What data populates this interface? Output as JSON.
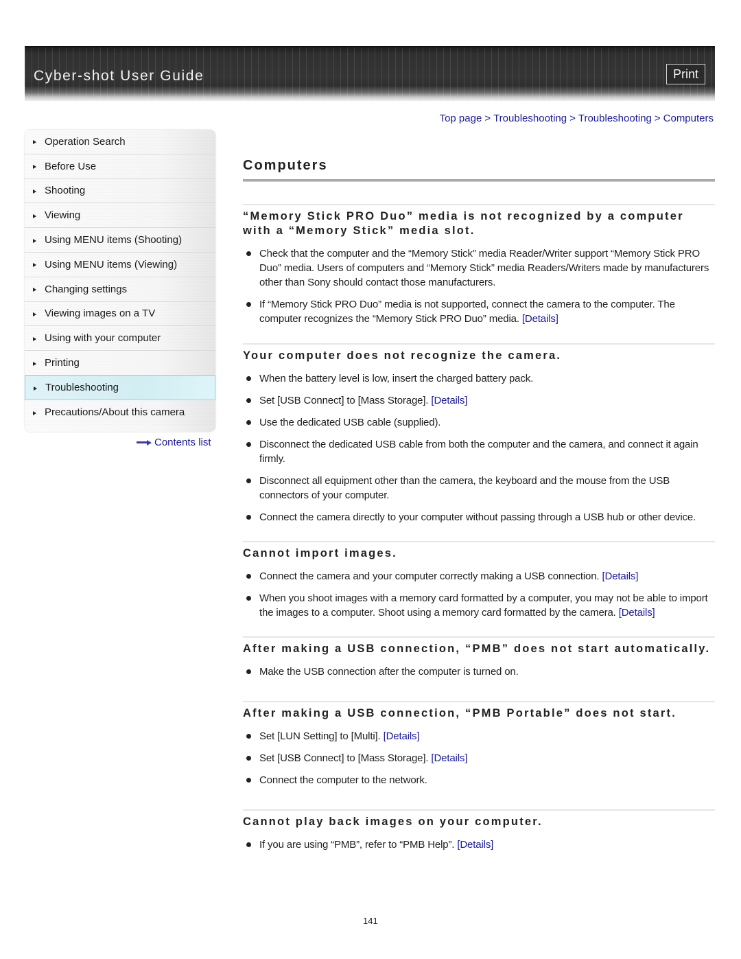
{
  "header": {
    "title": "Cyber-shot User Guide",
    "print_label": "Print"
  },
  "breadcrumb": [
    {
      "label": "Top page"
    },
    {
      "label": "Troubleshooting"
    },
    {
      "label": "Troubleshooting"
    },
    {
      "label": "Computers"
    }
  ],
  "breadcrumb_separator": ">",
  "sidebar": {
    "items": [
      {
        "label": "Operation Search",
        "active": false
      },
      {
        "label": "Before Use",
        "active": false
      },
      {
        "label": "Shooting",
        "active": false
      },
      {
        "label": "Viewing",
        "active": false
      },
      {
        "label": "Using MENU items (Shooting)",
        "active": false
      },
      {
        "label": "Using MENU items (Viewing)",
        "active": false
      },
      {
        "label": "Changing settings",
        "active": false
      },
      {
        "label": "Viewing images on a TV",
        "active": false
      },
      {
        "label": "Using with your computer",
        "active": false
      },
      {
        "label": "Printing",
        "active": false
      },
      {
        "label": "Troubleshooting",
        "active": true
      },
      {
        "label": "Precautions/About this camera",
        "active": false
      }
    ],
    "contents_link": "Contents list"
  },
  "main": {
    "title": "Computers",
    "sections": [
      {
        "heading": "“Memory Stick PRO Duo” media is not recognized by a computer with a “Memory Stick” media slot.",
        "items": [
          {
            "text": "Check that the computer and the “Memory Stick” media Reader/Writer support “Memory Stick PRO Duo” media. Users of computers and “Memory Stick” media Readers/Writers made by manufacturers other than Sony should contact those manufacturers.",
            "link": ""
          },
          {
            "text": "If “Memory Stick PRO Duo” media is not supported, connect the camera to the computer. The computer recognizes the “Memory Stick PRO Duo” media.",
            "link": "[Details]"
          }
        ]
      },
      {
        "heading": "Your computer does not recognize the camera.",
        "items": [
          {
            "text": "When the battery level is low, insert the charged battery pack.",
            "link": ""
          },
          {
            "text": "Set [USB Connect] to [Mass Storage].",
            "link": "[Details]"
          },
          {
            "text": "Use the dedicated USB cable (supplied).",
            "link": ""
          },
          {
            "text": "Disconnect the dedicated USB cable from both the computer and the camera, and connect it again firmly.",
            "link": ""
          },
          {
            "text": "Disconnect all equipment other than the camera, the keyboard and the mouse from the USB connectors of your computer.",
            "link": ""
          },
          {
            "text": "Connect the camera directly to your computer without passing through a USB hub or other device.",
            "link": ""
          }
        ]
      },
      {
        "heading": "Cannot import images.",
        "items": [
          {
            "text": "Connect the camera and your computer correctly making a USB connection.",
            "link": "[Details]"
          },
          {
            "text": "When you shoot images with a memory card formatted by a computer, you may not be able to import the images to a computer. Shoot using a memory card formatted by the camera.",
            "link": "[Details]"
          }
        ]
      },
      {
        "heading": "After making a USB connection, “PMB” does not start automatically.",
        "items": [
          {
            "text": "Make the USB connection after the computer is turned on.",
            "link": ""
          }
        ]
      },
      {
        "heading": "After making a USB connection, “PMB Portable” does not start.",
        "items": [
          {
            "text": "Set [LUN Setting] to [Multi].",
            "link": "[Details]"
          },
          {
            "text": "Set [USB Connect] to [Mass Storage].",
            "link": "[Details]"
          },
          {
            "text": "Connect the computer to the network.",
            "link": ""
          }
        ]
      },
      {
        "heading": "Cannot play back images on your computer.",
        "items": [
          {
            "text": "If you are using “PMB”, refer to “PMB Help”.",
            "link": "[Details]"
          }
        ]
      }
    ]
  },
  "page_number": "141",
  "colors": {
    "link": "#1a1a9a",
    "active_item_bg": "#d2eef3",
    "active_item_border": "#7fdcec",
    "banner_bg": "#333333"
  }
}
